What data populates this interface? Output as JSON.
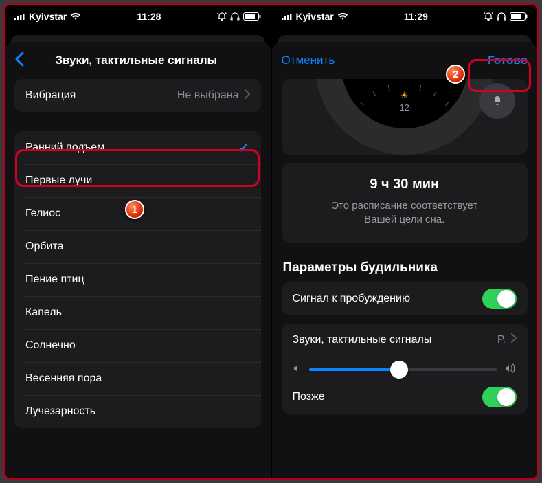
{
  "statusbar": {
    "carrier": "Kyivstar",
    "time": "11:28",
    "time_right": "11:29"
  },
  "left": {
    "title": "Звуки, тактильные сигналы",
    "vibration": {
      "label": "Вибрация",
      "value": "Не выбрана"
    },
    "sounds": [
      "Ранний подъем",
      "Первые лучи",
      "Гелиос",
      "Орбита",
      "Пение птиц",
      "Капель",
      "Солнечно",
      "Весенняя пора",
      "Лучезарность"
    ],
    "selected_index": 0
  },
  "right": {
    "cancel": "Отменить",
    "done": "Готово",
    "dial_number": "12",
    "duration": "9 ч 30 мин",
    "duration_sub1": "Это расписание соответствует",
    "duration_sub2": "Вашей цели сна.",
    "section": "Параметры будильника",
    "wake_label": "Сигнал к пробуждению",
    "sounds_label": "Звуки, тактильные сигналы",
    "sounds_value": "Р.",
    "snooze_label": "Позже"
  },
  "badges": {
    "one": "1",
    "two": "2"
  }
}
